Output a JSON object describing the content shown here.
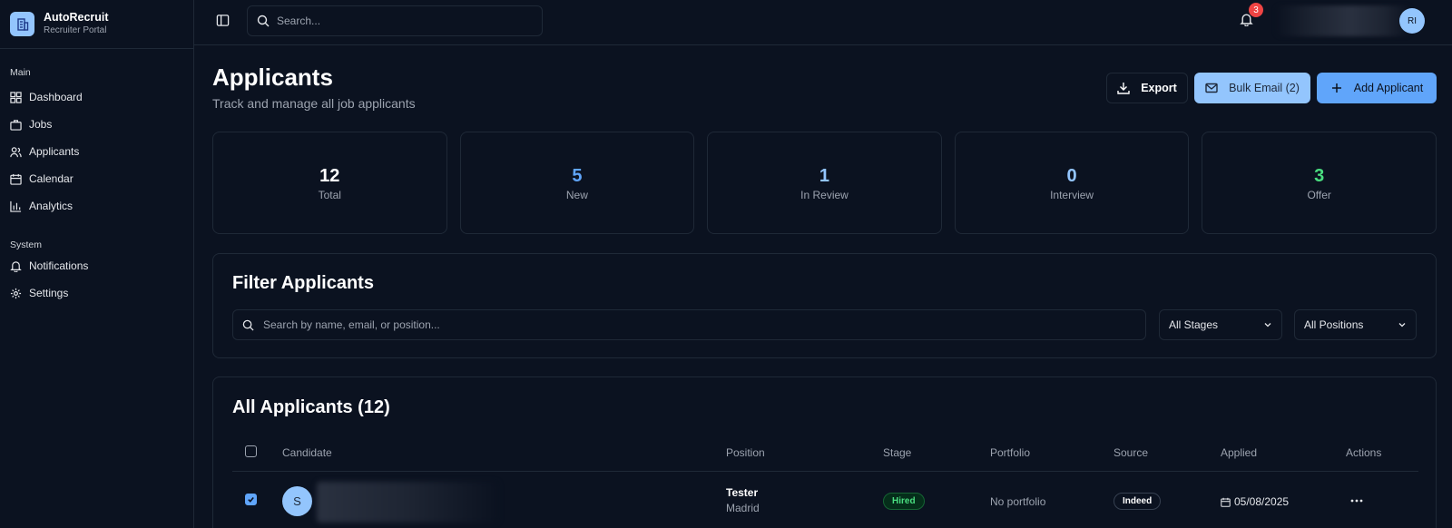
{
  "brand": {
    "name": "AutoRecruit",
    "subtitle": "Recruiter Portal",
    "icon": "building-icon"
  },
  "sidebar": {
    "sections": [
      {
        "label": "Main",
        "items": [
          {
            "label": "Dashboard",
            "icon": "dashboard-icon"
          },
          {
            "label": "Jobs",
            "icon": "briefcase-icon"
          },
          {
            "label": "Applicants",
            "icon": "users-icon"
          },
          {
            "label": "Calendar",
            "icon": "calendar-icon"
          },
          {
            "label": "Analytics",
            "icon": "bar-chart-icon"
          }
        ]
      },
      {
        "label": "System",
        "items": [
          {
            "label": "Notifications",
            "icon": "bell-icon"
          },
          {
            "label": "Settings",
            "icon": "gear-icon"
          }
        ]
      }
    ]
  },
  "header": {
    "search_placeholder": "Search...",
    "notification_count": "3",
    "user_initials": "RI"
  },
  "page": {
    "title": "Applicants",
    "subtitle": "Track and manage all job applicants",
    "buttons": {
      "export": "Export",
      "bulk_email": "Bulk Email (2)",
      "add_applicant": "Add Applicant"
    }
  },
  "stats": [
    {
      "value": "12",
      "label": "Total",
      "color": "#ffffff"
    },
    {
      "value": "5",
      "label": "New",
      "color": "#60a5fa"
    },
    {
      "value": "1",
      "label": "In Review",
      "color": "#93c5fd"
    },
    {
      "value": "0",
      "label": "Interview",
      "color": "#93c5fd"
    },
    {
      "value": "3",
      "label": "Offer",
      "color": "#4ade80"
    }
  ],
  "filters": {
    "title": "Filter Applicants",
    "search_placeholder": "Search by name, email, or position...",
    "stage_select": "All Stages",
    "position_select": "All Positions"
  },
  "table": {
    "title": "All Applicants (12)",
    "columns": [
      "Candidate",
      "Position",
      "Stage",
      "Portfolio",
      "Source",
      "Applied",
      "Actions"
    ],
    "rows": [
      {
        "checked": true,
        "avatar_initial": "S",
        "position": "Tester",
        "location": "Madrid",
        "stage": "Hired",
        "portfolio": "No portfolio",
        "source": "Indeed",
        "applied": "05/08/2025"
      }
    ]
  },
  "colors": {
    "accent": "#60a5fa",
    "accent_light": "#93c5fd",
    "success": "#4ade80",
    "danger": "#ef4444",
    "background": "#0b1220",
    "border": "#1f2937"
  }
}
